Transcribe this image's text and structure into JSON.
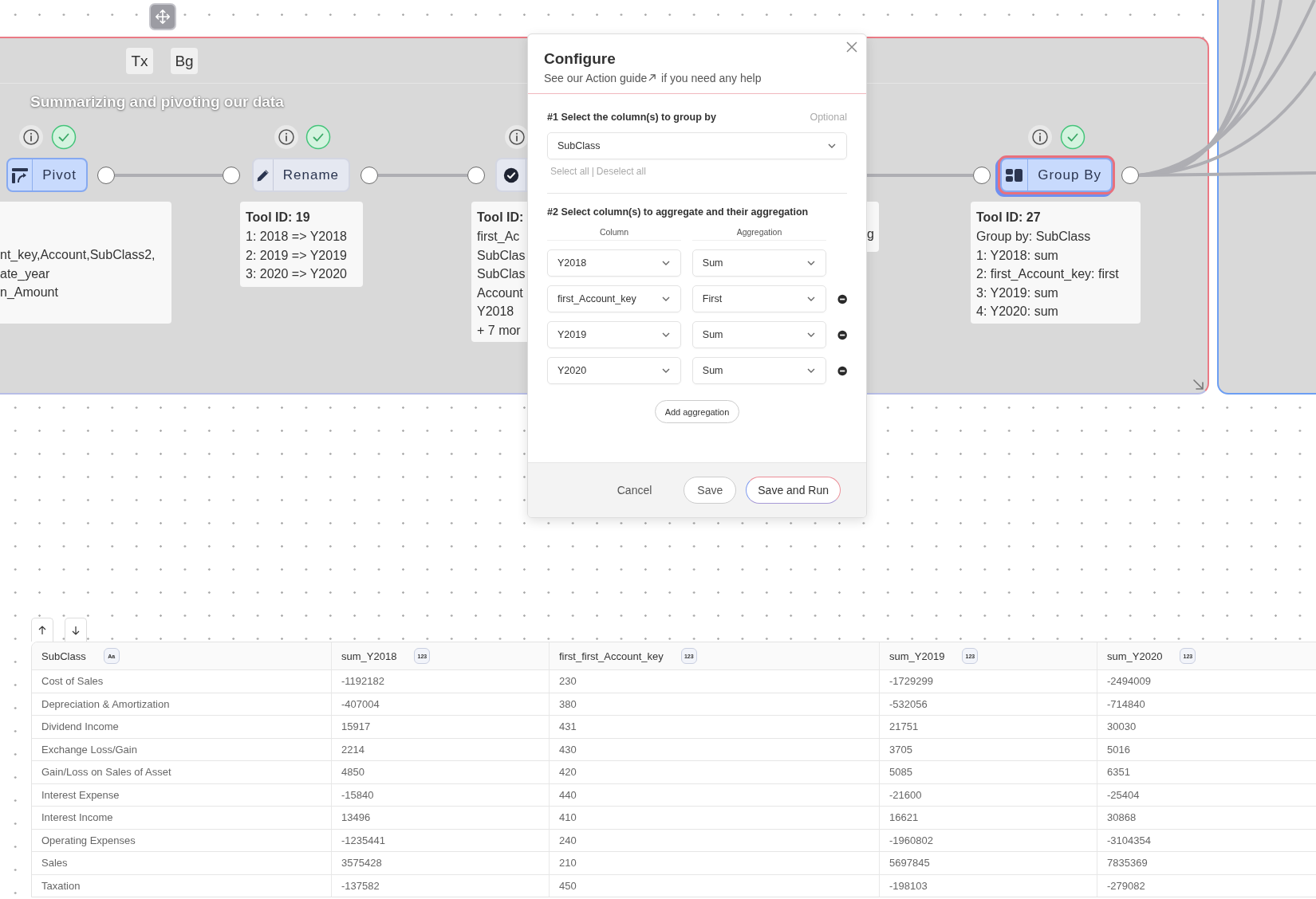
{
  "group": {
    "title": "Summarizing and pivoting our data",
    "format_buttons": [
      "Tx",
      "Bg"
    ]
  },
  "nodes": [
    {
      "kind": "pivot",
      "label": "Pivot",
      "selected": true,
      "active": false,
      "done": true,
      "card": {
        "lines": [
          "nt_key,Account,SubClass2,",
          "ate_year",
          "n_Amount"
        ]
      }
    },
    {
      "kind": "rename",
      "label": "Rename",
      "selected": false,
      "active": false,
      "done": true,
      "card": {
        "title": "Tool ID: 19",
        "lines": [
          "1: 2018 => Y2018",
          "2: 2019 => Y2019",
          "3: 2020 => Y2020"
        ]
      }
    },
    {
      "kind": "check",
      "selected": false,
      "active": false,
      "card": {
        "title": "Tool ID:",
        "lines": [
          "first_Ac",
          "SubClas",
          "SubClas",
          "Account",
          "Y2018",
          "+ 7 mor"
        ]
      }
    },
    {
      "kind": "group",
      "label": "Group By",
      "selected": true,
      "active": true,
      "done": true,
      "card": {
        "title": "Tool ID: 27",
        "lines": [
          "Group by: SubClass",
          "1: Y2018: sum",
          "2: first_Account_key: first",
          "3: Y2019: sum",
          "4: Y2020: sum"
        ]
      }
    }
  ],
  "side_card": {
    "lines": [
      "g"
    ]
  },
  "modal": {
    "title": "Configure",
    "subtitle_before": "See our ",
    "link": "Action guide",
    "subtitle_after": " if you need any help",
    "step1": {
      "heading": "#1 Select the column(s) to group by",
      "hint": "Optional",
      "value": "SubClass",
      "select_all": "Select all",
      "separator": "|",
      "deselect_all": "Deselect all"
    },
    "step2": {
      "heading": "#2 Select column(s) to aggregate and their aggregation",
      "column_header": "Column",
      "aggregation_header": "Aggregation",
      "rows": [
        {
          "column": "Y2018",
          "aggregation": "Sum",
          "removable": false
        },
        {
          "column": "first_Account_key",
          "aggregation": "First",
          "removable": true
        },
        {
          "column": "Y2019",
          "aggregation": "Sum",
          "removable": true
        },
        {
          "column": "Y2020",
          "aggregation": "Sum",
          "removable": true
        }
      ],
      "add_button": "Add aggregation"
    },
    "buttons": [
      {
        "label": "Cancel",
        "kind": "text"
      },
      {
        "label": "Save",
        "kind": "outline"
      },
      {
        "label": "Save and Run",
        "kind": "primary"
      }
    ]
  },
  "table": {
    "columns": [
      {
        "name": "SubClass",
        "badge": "Aa"
      },
      {
        "name": "sum_Y2018",
        "badge": "123"
      },
      {
        "name": "first_first_Account_key",
        "badge": "123"
      },
      {
        "name": "sum_Y2019",
        "badge": "123"
      },
      {
        "name": "sum_Y2020",
        "badge": "123"
      }
    ],
    "rows": [
      [
        "Cost of Sales",
        "-1192182",
        "230",
        "-1729299",
        "-2494009"
      ],
      [
        "Depreciation & Amortization",
        "-407004",
        "380",
        "-532056",
        "-714840"
      ],
      [
        "Dividend Income",
        "15917",
        "431",
        "21751",
        "30030"
      ],
      [
        "Exchange Loss/Gain",
        "2214",
        "430",
        "3705",
        "5016"
      ],
      [
        "Gain/Loss on Sales of Asset",
        "4850",
        "420",
        "5085",
        "6351"
      ],
      [
        "Interest Expense",
        "-15840",
        "440",
        "-21600",
        "-25404"
      ],
      [
        "Interest Income",
        "13496",
        "410",
        "16621",
        "30868"
      ],
      [
        "Operating Expenses",
        "-1235441",
        "240",
        "-1960802",
        "-3104354"
      ],
      [
        "Sales",
        "3575428",
        "210",
        "5697845",
        "7835369"
      ],
      [
        "Taxation",
        "-137582",
        "450",
        "-198103",
        "-279082"
      ]
    ]
  }
}
